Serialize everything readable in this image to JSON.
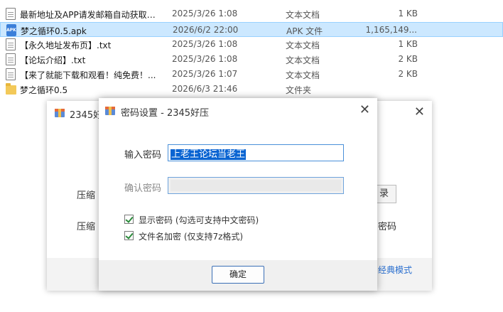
{
  "files": [
    {
      "name": "最新地址及APP请发邮箱自动获取！...",
      "date": "2025/3/26 1:08",
      "type": "文本文档",
      "size": "1 KB",
      "icon": "document-icon"
    },
    {
      "name": "梦之循环0.5.apk",
      "date": "2026/6/2 22:00",
      "type": "APK 文件",
      "size": "1,165,149...",
      "icon": "apk-icon",
      "selected": true
    },
    {
      "name": "【永久地址发布页】.txt",
      "date": "2025/3/26 1:08",
      "type": "文本文档",
      "size": "1 KB",
      "icon": "document-icon"
    },
    {
      "name": "【论坛介绍】.txt",
      "date": "2025/3/26 1:08",
      "type": "文本文档",
      "size": "2 KB",
      "icon": "document-icon"
    },
    {
      "name": "【来了就能下载和观看！纯免费！...",
      "date": "2025/3/26 1:07",
      "type": "文本文档",
      "size": "2 KB",
      "icon": "document-icon"
    },
    {
      "name": "梦之循环0.5",
      "date": "2026/6/3 21:46",
      "type": "文件夹",
      "size": "",
      "icon": "folder-icon"
    }
  ],
  "apk_icon_text": "APK",
  "bg_dialog": {
    "title": "2345好",
    "close": "✕",
    "label1": "压缩",
    "label2": "压缩",
    "button": "录",
    "right_text": "密码",
    "link": "经典模式"
  },
  "pw_dialog": {
    "title": "密码设置 - 2345好压",
    "close": "✕",
    "password_label": "输入密码",
    "password_value": "上老王论坛当老王",
    "confirm_label": "确认密码",
    "show_password": "显示密码 (勾选可支持中文密码)",
    "encrypt_filenames": "文件名加密 (仅支持7z格式)",
    "ok": "确定"
  },
  "colors": {
    "selection": "#cce8ff",
    "text_selection": "#0a64d2",
    "link": "#2a6fcf",
    "checkmark": "#2a8a3a"
  }
}
